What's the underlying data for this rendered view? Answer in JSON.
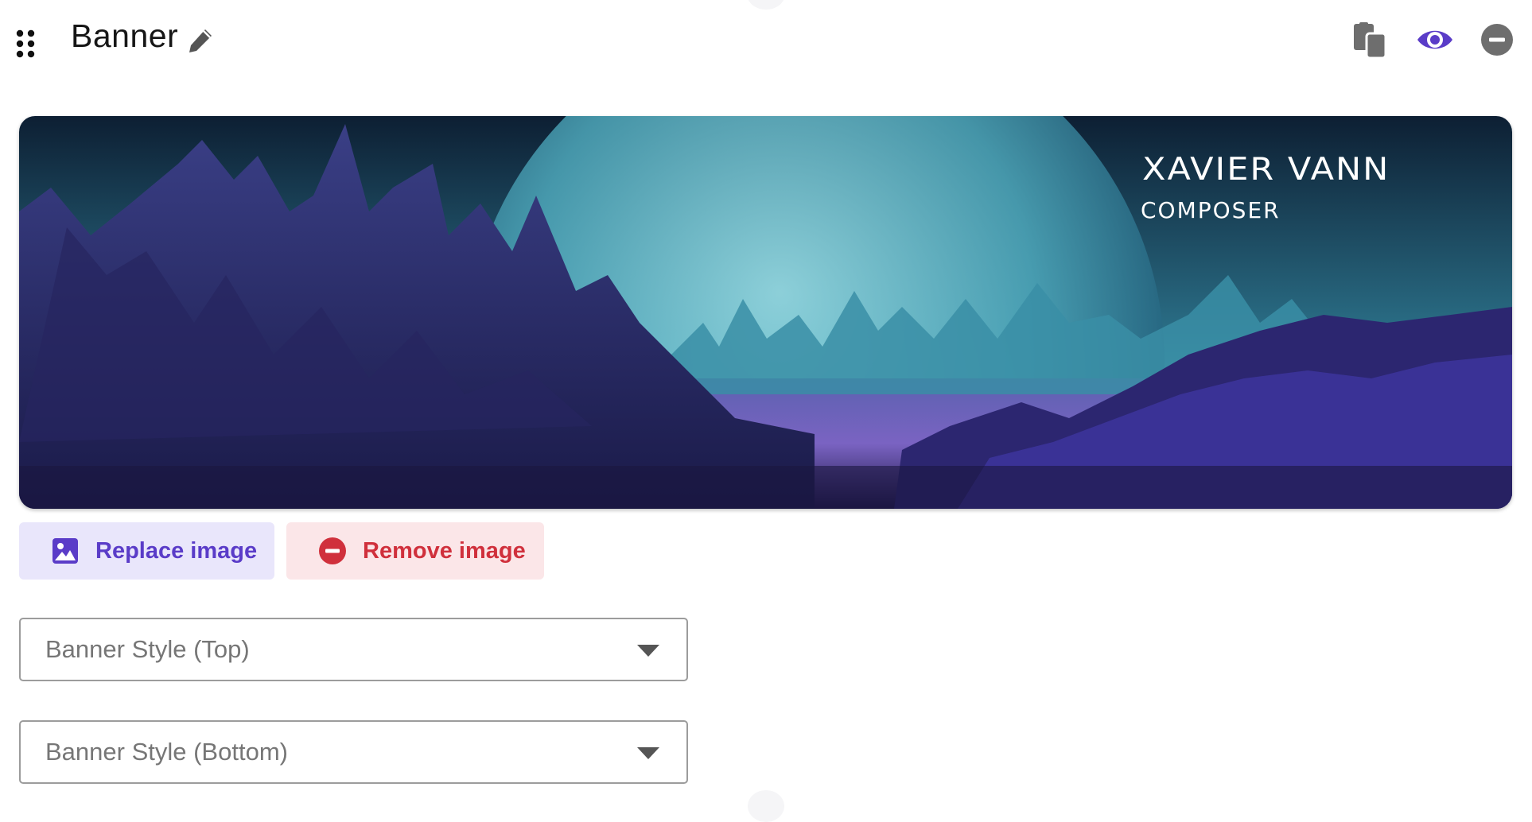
{
  "block": {
    "title": "Banner"
  },
  "banner": {
    "artist_name": "XAVIER VANN",
    "artist_role": "COMPOSER"
  },
  "actions": {
    "replace_label": "Replace image",
    "remove_label": "Remove image"
  },
  "fields": {
    "top_style_placeholder": "Banner Style (Top)",
    "bottom_style_placeholder": "Banner Style (Bottom)"
  },
  "icons": [
    "drag-handle-icon",
    "pencil-icon",
    "copy-icon",
    "eye-icon",
    "minus-circle-icon",
    "image-icon",
    "minus-circle-icon",
    "caret-down-icon"
  ],
  "colors": {
    "accent_purple": "#5a3cc8",
    "accent_red": "#d0303c",
    "replace_bg": "#e9e6fb",
    "remove_bg": "#fbe6e8"
  }
}
